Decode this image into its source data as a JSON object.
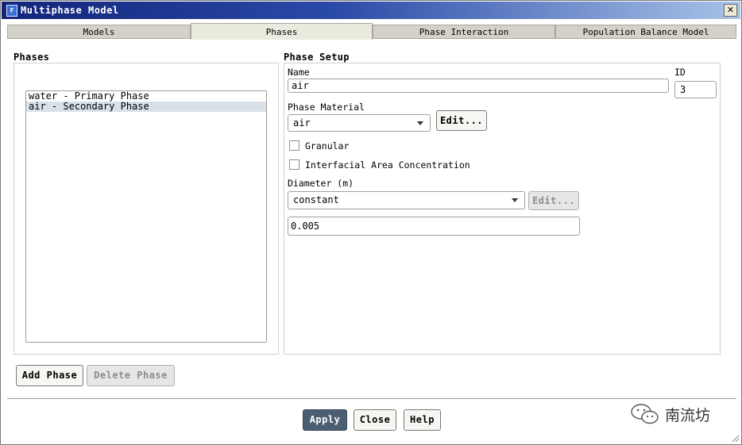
{
  "window": {
    "title": "Multiphase Model",
    "app_icon": "F",
    "close_glyph": "✕"
  },
  "tabs": [
    {
      "label": "Models",
      "active": false
    },
    {
      "label": "Phases",
      "active": true
    },
    {
      "label": "Phase Interaction",
      "active": false
    },
    {
      "label": "Population Balance Model",
      "active": false
    }
  ],
  "phases": {
    "heading": "Phases",
    "items": [
      {
        "label": "water - Primary Phase",
        "selected": false
      },
      {
        "label": "air - Secondary Phase",
        "selected": true
      }
    ],
    "add_label": "Add Phase",
    "delete_label": "Delete Phase"
  },
  "setup": {
    "heading": "Phase Setup",
    "name_label": "Name",
    "name_value": "air",
    "id_label": "ID",
    "id_value": "3",
    "material_label": "Phase Material",
    "material_value": "air",
    "material_edit_label": "Edit...",
    "granular_label": "Granular",
    "granular_checked": false,
    "iac_label": "Interfacial Area Concentration",
    "iac_checked": false,
    "diameter_label": "Diameter (m)",
    "diameter_method": "constant",
    "diameter_edit_label": "Edit...",
    "diameter_value": "0.005"
  },
  "footer": {
    "apply_label": "Apply",
    "close_label": "Close",
    "help_label": "Help"
  },
  "watermark": {
    "text": "南流坊",
    "icon": "wechat-icon"
  },
  "colors": {
    "title_bar_start": "#12257a",
    "title_bar_end": "#a8c3e8",
    "apply_button": "#4c5e72",
    "selection": "#d8e0e8"
  }
}
